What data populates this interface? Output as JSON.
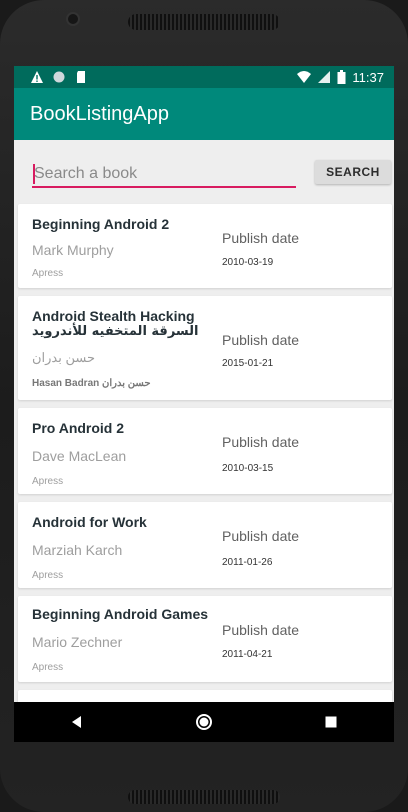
{
  "status_bar": {
    "time": "11:37",
    "icons": [
      "warning-icon",
      "circle-notification-icon",
      "sd-card-icon",
      "wifi-icon",
      "signal-icon",
      "battery-icon"
    ]
  },
  "app_bar": {
    "title": "BookListingApp"
  },
  "search": {
    "placeholder": "Search a book",
    "button_label": "SEARCH"
  },
  "books": [
    {
      "title": "Beginning Android 2",
      "subtitle": "",
      "author": "Mark Murphy",
      "publisher": "Apress",
      "date_label": "Publish date",
      "date": "2010-03-19"
    },
    {
      "title": "Android Stealth Hacking",
      "subtitle": "السرقة المتخفيه للأندرويد",
      "author": "حسن بدران",
      "publisher": "Hasan Badran حسن بدران",
      "date_label": "Publish date",
      "date": "2015-01-21"
    },
    {
      "title": "Pro Android 2",
      "subtitle": "",
      "author": "Dave MacLean",
      "publisher": "Apress",
      "date_label": "Publish date",
      "date": "2010-03-15"
    },
    {
      "title": "Android for Work",
      "subtitle": "",
      "author": "Marziah Karch",
      "publisher": "Apress",
      "date_label": "Publish date",
      "date": "2011-01-26"
    },
    {
      "title": "Beginning Android Games",
      "subtitle": "",
      "author": "Mario Zechner",
      "publisher": "Apress",
      "date_label": "Publish date",
      "date": "2011-04-21"
    }
  ],
  "colors": {
    "status_bar": "#006b5c",
    "app_bar": "#00897b",
    "accent": "#d81b60",
    "background": "#eeeeee"
  },
  "nav": {
    "icons": [
      "back-icon",
      "home-icon",
      "recents-icon"
    ]
  }
}
